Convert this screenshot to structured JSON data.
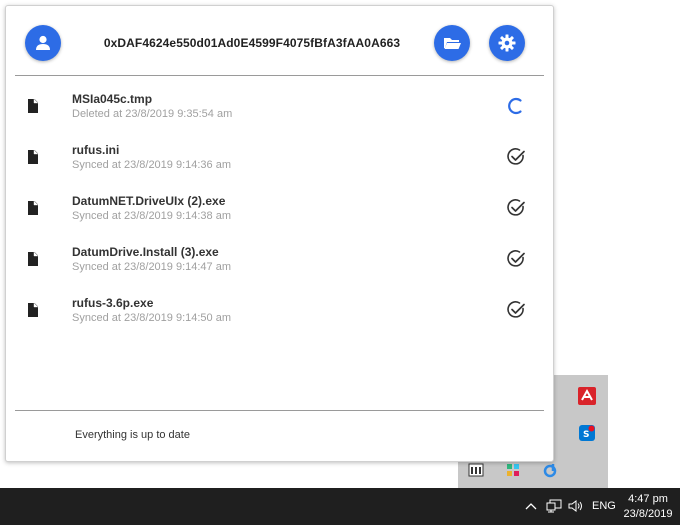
{
  "header": {
    "address": "0xDAF4624e550d01Ad0E4599F4075fBfA3fAA0A663",
    "user_icon": "user-icon",
    "folder_icon": "folder-open-icon",
    "settings_icon": "gear-icon",
    "accent": "#2d6ce6"
  },
  "files": [
    {
      "name": "MSIa045c.tmp",
      "status": "Deleted at 23/8/2019 9:35:54 am",
      "state": "syncing"
    },
    {
      "name": "rufus.ini",
      "status": "Synced at 23/8/2019 9:14:36 am",
      "state": "synced"
    },
    {
      "name": "DatumNET.DriveUIx (2).exe",
      "status": "Synced at 23/8/2019 9:14:38 am",
      "state": "synced"
    },
    {
      "name": "DatumDrive.Install (3).exe",
      "status": "Synced at 23/8/2019 9:14:47 am",
      "state": "synced"
    },
    {
      "name": "rufus-3.6p.exe",
      "status": "Synced at 23/8/2019 9:14:50 am",
      "state": "synced"
    }
  ],
  "footer": {
    "message": "Everything is up to date"
  },
  "taskbar": {
    "language": "ENG",
    "time": "4:47 pm",
    "date": "23/8/2019"
  }
}
